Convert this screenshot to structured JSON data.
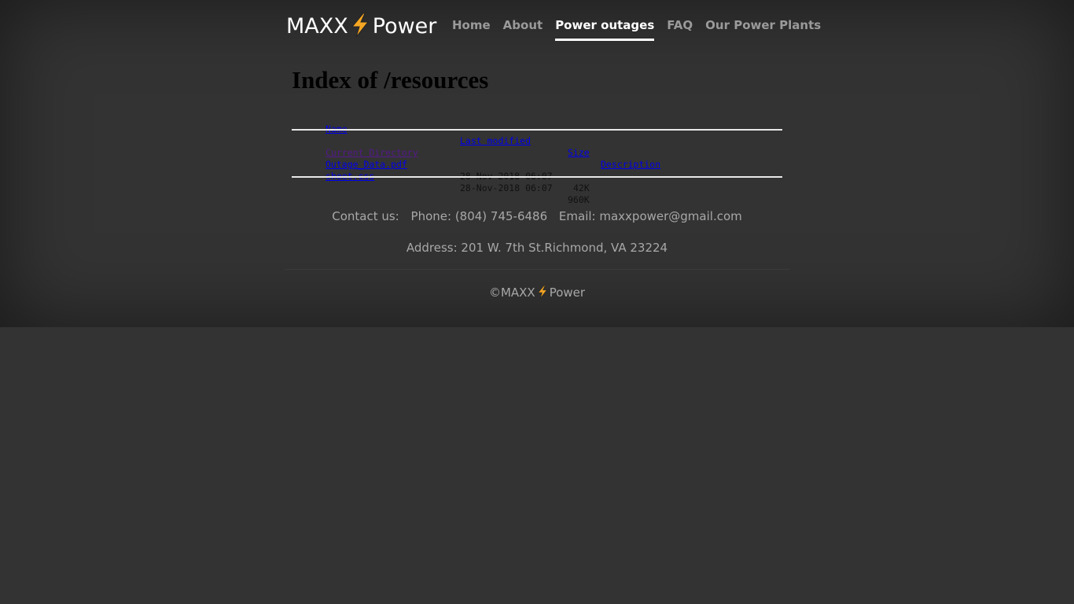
{
  "brand": {
    "left": "MAXX",
    "right": "Power",
    "icon": "lightning-bolt-icon"
  },
  "nav": {
    "items": [
      {
        "label": "Home",
        "active": false
      },
      {
        "label": "About",
        "active": false
      },
      {
        "label": "Power outages",
        "active": true
      },
      {
        "label": "FAQ",
        "active": false
      },
      {
        "label": "Our Power Plants",
        "active": false
      }
    ]
  },
  "index": {
    "title": "Index of /resources",
    "headers": {
      "name": "Name",
      "modified": "Last modified",
      "size": "Size",
      "description": "Description"
    },
    "rows": [
      {
        "name": "Current Directory",
        "modified": "",
        "size": "-",
        "description": "",
        "visited": true
      },
      {
        "name": "Outage_Data.pdf",
        "modified": "28-Nov-2018 06:07",
        "size": "42K",
        "description": "",
        "visited": false
      },
      {
        "name": "sheet.css",
        "modified": "28-Nov-2018 06:07",
        "size": "960K",
        "description": "",
        "visited": false
      }
    ]
  },
  "footer": {
    "contact_label": "Contact us:",
    "phone": "Phone: (804) 745-6486",
    "email": "Email: maxxpower@gmail.com",
    "address": "Address: 201 W. 7th St.Richmond, VA 23224",
    "copyright_left": "©MAXX",
    "copyright_right": "Power"
  },
  "colors": {
    "background": "#333333",
    "bolt": "#f5a623",
    "link": "#0000ee",
    "visited": "#551a8b"
  }
}
